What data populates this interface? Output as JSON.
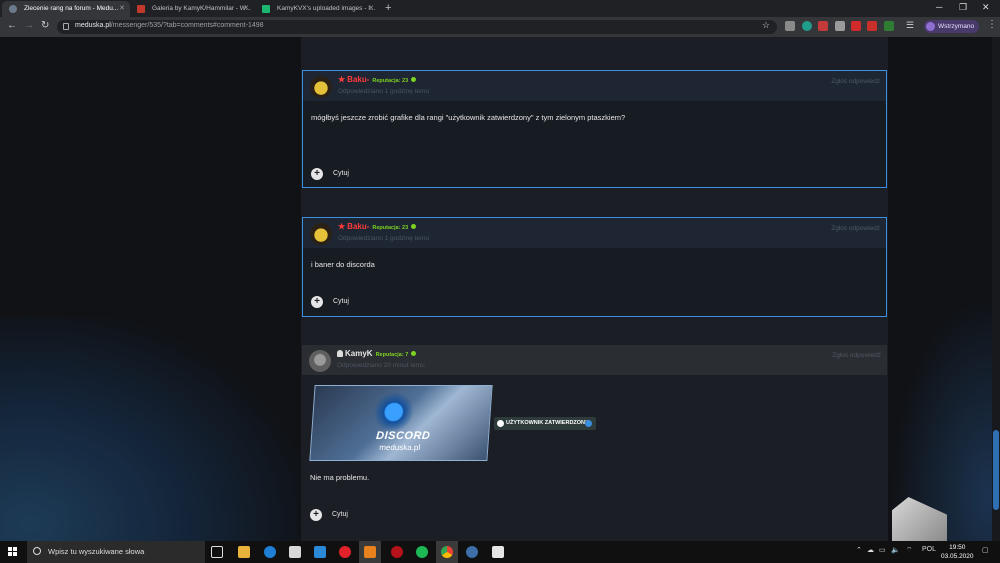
{
  "browser": {
    "tabs": [
      {
        "title": "Zlecenie rang na forum - Medu...",
        "active": true
      },
      {
        "title": "Galeria by KamyK/Hammilar - W...",
        "active": false
      },
      {
        "title": "KamyKVX's uploaded images - I...",
        "active": false
      }
    ],
    "url_host": "meduska.pl",
    "url_path": "/messenger/535/?tab=comments#comment-1498",
    "profile_label": "Wstrzymano"
  },
  "comments": [
    {
      "author": "Baku-",
      "reputation": "Reputacja: 23",
      "time": "Odpowiedziano 1 godzinę temu",
      "report": "Zgłoś odpowiedź",
      "text": "mógłbyś jeszcze zrobić grafike dla rangi \"użytkownik zatwierdzony\" z tym zielonym ptaszkiem?",
      "cite": "Cytuj"
    },
    {
      "author": "Baku-",
      "reputation": "Reputacja: 23",
      "time": "Odpowiedziano 1 godzinę temu",
      "report": "Zgłoś odpowiedź",
      "text": "i baner do discorda",
      "cite": "Cytuj"
    },
    {
      "author": "KamyK",
      "reputation": "Reputacja: 7",
      "time": "Odpowiedziano 20 minut temu",
      "report": "Zgłoś odpowiedź",
      "banner_title": "DISCORD",
      "banner_sub": "meduska.pl",
      "badge": "UŻYTKOWNIK ZATWIERDZONY",
      "text": "Nie ma problemu.",
      "cite": "Cytuj"
    }
  ],
  "taskbar": {
    "search_placeholder": "Wpisz tu wyszukiwane słowa",
    "lang": "POL",
    "time": "19:50",
    "date": "03.05.2020"
  },
  "colors": {
    "accent": "#3a8fe0",
    "author_red": "#ff3b3b",
    "reputation_green": "#7ed321"
  }
}
